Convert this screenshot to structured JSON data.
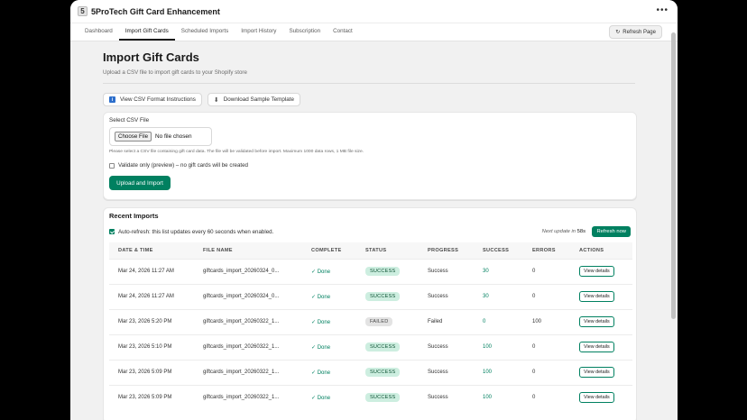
{
  "app": {
    "logo_letter": "5",
    "title": "5ProTech Gift Card Enhancement",
    "more_glyph": "•••"
  },
  "nav": {
    "tabs": [
      {
        "label": "Dashboard"
      },
      {
        "label": "Import Gift Cards"
      },
      {
        "label": "Scheduled Imports"
      },
      {
        "label": "Import History"
      },
      {
        "label": "Subscription"
      },
      {
        "label": "Contact"
      }
    ],
    "active_tab": 1,
    "refresh_label": "Refresh Page",
    "refresh_glyph": "↻"
  },
  "page": {
    "title": "Import Gift Cards",
    "subtitle": "Upload a CSV file to import gift cards to your Shopify store"
  },
  "actions": {
    "view_instructions": "View CSV Format Instructions",
    "info_glyph": "i",
    "download_template": "Download Sample Template",
    "download_glyph": "⬇"
  },
  "upload": {
    "label": "Select CSV File",
    "choose_file": "Choose File",
    "no_file": "No file chosen",
    "help": "Please select a CSV file containing gift card data. The file will be validated before import. Maximum 1000 data rows, 1 MB file size.",
    "validate_only_label": "Validate only (preview) – no gift cards will be created",
    "validate_only_checked": false,
    "submit_label": "Upload and Import"
  },
  "recent": {
    "title": "Recent Imports",
    "auto_refresh_checked": true,
    "auto_refresh_label": "Auto-refresh: this list updates every 60 seconds when enabled.",
    "next_update_prefix": "Next update in ",
    "next_update_secs": "58s",
    "refresh_now": "Refresh now",
    "columns": [
      "DATE & TIME",
      "FILE NAME",
      "COMPLETE",
      "STATUS",
      "PROGRESS",
      "SUCCESS",
      "ERRORS",
      "ACTIONS"
    ],
    "rows": [
      {
        "date": "Mar 24, 2026 11:27 AM",
        "file": "giftcards_import_20260324_0...",
        "complete": "✓ Done",
        "status": "SUCCESS",
        "progress": "Success",
        "success": "30",
        "errors": "0",
        "action": "View details"
      },
      {
        "date": "Mar 24, 2026 11:27 AM",
        "file": "giftcards_import_20260324_0...",
        "complete": "✓ Done",
        "status": "SUCCESS",
        "progress": "Success",
        "success": "30",
        "errors": "0",
        "action": "View details"
      },
      {
        "date": "Mar 23, 2026 5:20 PM",
        "file": "giftcards_import_20260322_1...",
        "complete": "✓ Done",
        "status": "FAILED",
        "progress": "Failed",
        "success": "0",
        "errors": "100",
        "action": "View details"
      },
      {
        "date": "Mar 23, 2026 5:10 PM",
        "file": "giftcards_import_20260322_1...",
        "complete": "✓ Done",
        "status": "SUCCESS",
        "progress": "Success",
        "success": "100",
        "errors": "0",
        "action": "View details"
      },
      {
        "date": "Mar 23, 2026 5:09 PM",
        "file": "giftcards_import_20260322_1...",
        "complete": "✓ Done",
        "status": "SUCCESS",
        "progress": "Success",
        "success": "100",
        "errors": "0",
        "action": "View details"
      },
      {
        "date": "Mar 23, 2026 5:09 PM",
        "file": "giftcards_import_20260322_1...",
        "complete": "✓ Done",
        "status": "SUCCESS",
        "progress": "Success",
        "success": "100",
        "errors": "0",
        "action": "View details"
      }
    ]
  },
  "colors": {
    "primary": "#008060",
    "success_badge_bg": "#cdeee0",
    "failed_badge_bg": "#e3e3e3"
  }
}
